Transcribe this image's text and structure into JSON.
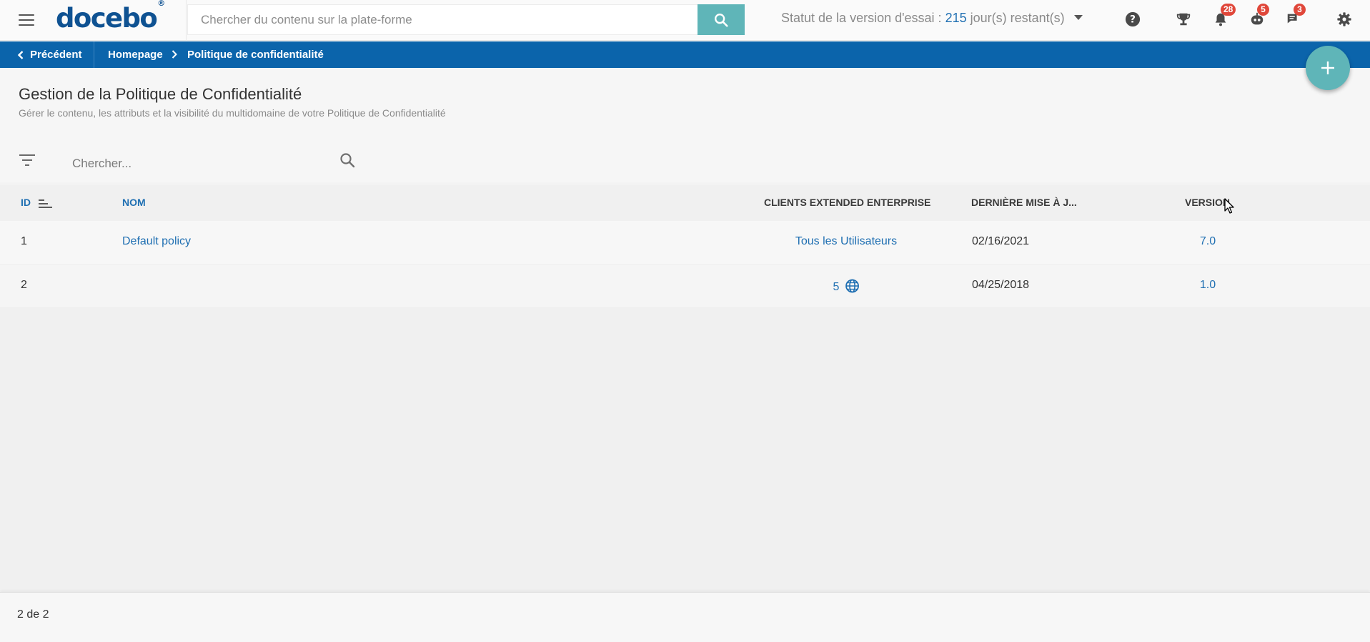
{
  "topbar": {
    "logo_text": "docebo",
    "logo_mark": "®",
    "search_placeholder": "Chercher du contenu sur la plate-forme",
    "trial_label": "Statut de la version d'essai :",
    "trial_days": "215",
    "trial_suffix": "jour(s) restant(s)",
    "badges": {
      "notifications": "28",
      "bot": "5",
      "messages": "3"
    }
  },
  "breadcrumb": {
    "back_label": "Précédent",
    "home_label": "Homepage",
    "current_label": "Politique de confidentialité"
  },
  "page": {
    "title": "Gestion de la Politique de Confidentialité",
    "subtitle": "Gérer le contenu, les attributs et la visibilité du multidomaine de votre Politique de Confidentialité",
    "search_placeholder": "Chercher..."
  },
  "table": {
    "columns": {
      "id": "ID",
      "name": "NOM",
      "clients": "CLIENTS EXTENDED ENTERPRISE",
      "updated": "DERNIÈRE MISE À J...",
      "version": "VERSION"
    },
    "rows": [
      {
        "id": "1",
        "name": "Default policy",
        "clients": "Tous les Utilisateurs",
        "updated": "02/16/2021",
        "version": "7.0"
      },
      {
        "id": "2",
        "name": "",
        "clients": "5",
        "updated": "04/25/2018",
        "version": "1.0"
      }
    ]
  },
  "footer": {
    "count": "2 de 2"
  },
  "colors": {
    "brand": "#0f5292",
    "accent_teal": "#5fb5b8",
    "breadcrumb_bg": "#0b64ab",
    "link": "#1f6fb2",
    "badge": "#e0473a"
  },
  "icons": [
    "menu-icon",
    "search-icon",
    "help-icon",
    "trophy-icon",
    "bell-icon",
    "bot-icon",
    "chat-icon",
    "gear-icon",
    "chevron-left-icon",
    "chevron-right-icon",
    "plus-icon",
    "filter-icon",
    "sort-icon",
    "globe-icon"
  ]
}
